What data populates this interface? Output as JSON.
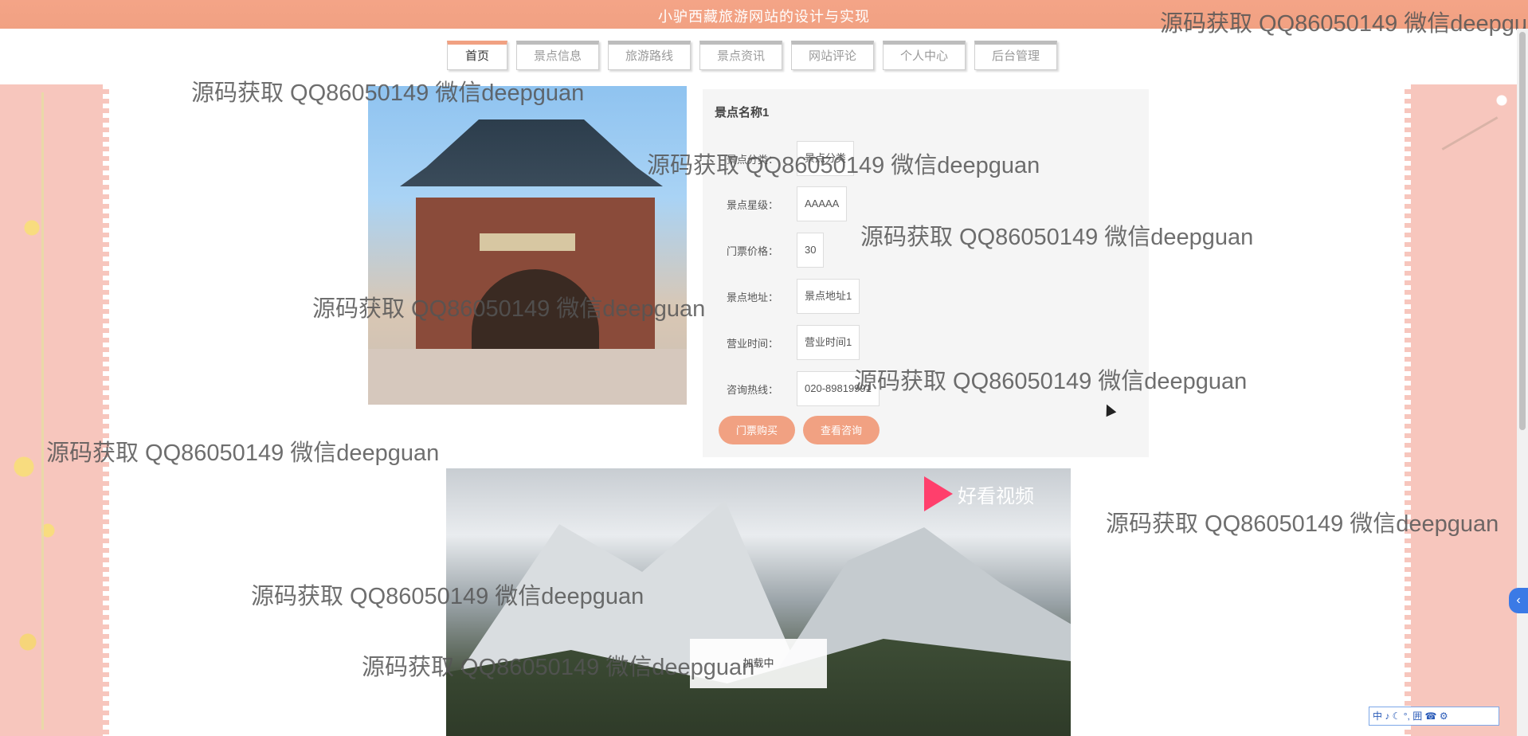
{
  "header": {
    "site_title": "小驴西藏旅游网站的设计与实现"
  },
  "nav": {
    "items": [
      "首页",
      "景点信息",
      "旅游路线",
      "景点资讯",
      "网站评论",
      "个人中心",
      "后台管理"
    ],
    "active": "首页"
  },
  "attraction": {
    "name": "景点名称1",
    "fields": [
      {
        "label": "景点分类：",
        "value": "景点分类"
      },
      {
        "label": "景点星级：",
        "value": "AAAAA"
      },
      {
        "label": "门票价格：",
        "value": "30"
      },
      {
        "label": "景点地址：",
        "value": "景点地址1"
      },
      {
        "label": "营业时间：",
        "value": "营业时间1"
      },
      {
        "label": "咨询热线：",
        "value": "020-89819991"
      }
    ],
    "buttons": {
      "book": "门票购买",
      "consult": "查看咨询"
    }
  },
  "video": {
    "brand": "好看视频",
    "status": "加载中"
  },
  "watermark": "源码获取 QQ86050149 微信deepguan",
  "ime": {
    "text": "中 ♪ ☾ °, 囲 ☎ ⚙"
  },
  "side_tab": {
    "label": "‹"
  },
  "colors": {
    "accent": "#f1a182",
    "page_bg": "#f7c9bf"
  }
}
